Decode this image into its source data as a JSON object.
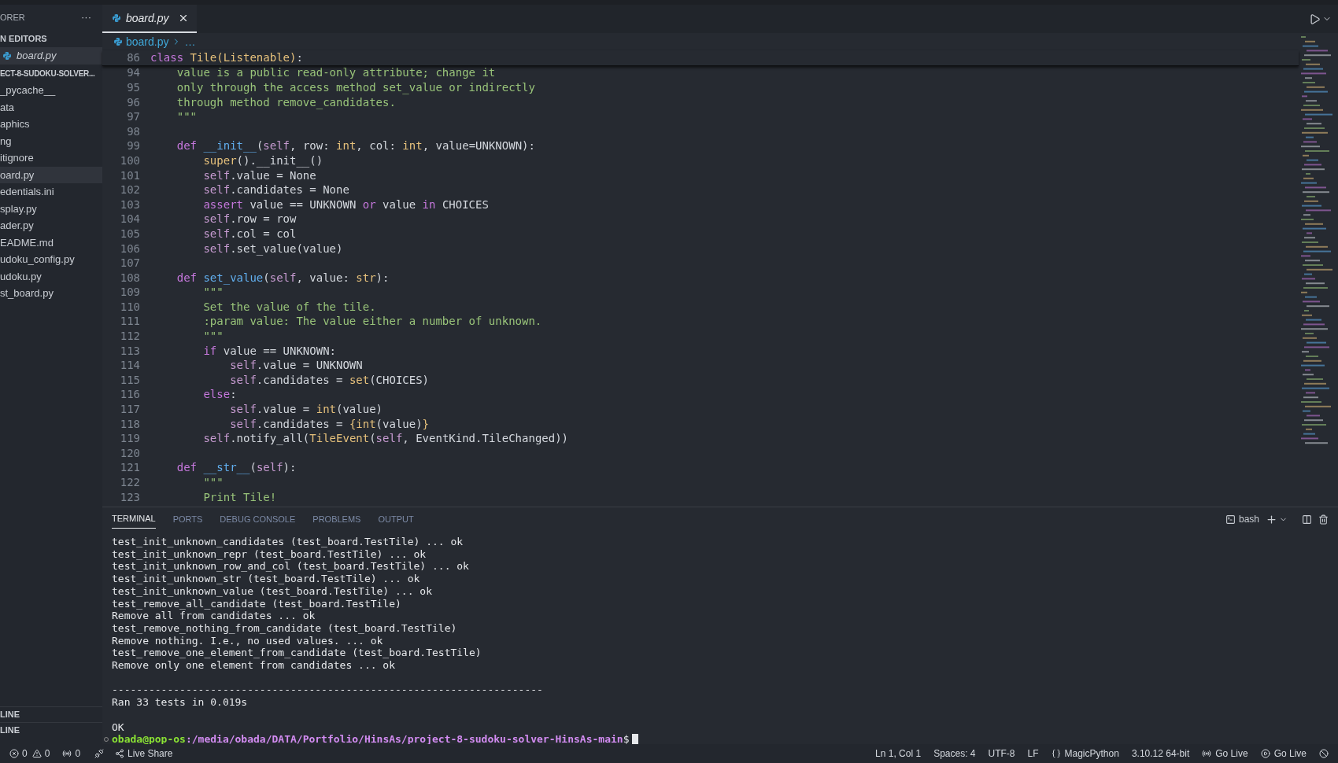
{
  "sidebar": {
    "title": "ORER",
    "more": "···",
    "open_editors": {
      "label": "N EDITORS",
      "items": [
        {
          "name": "board.py",
          "selected": true
        }
      ]
    },
    "folder": {
      "label": "ECT-8-SUDOKU-SOLVER...",
      "items": [
        {
          "name": "_pycache__",
          "selected": false
        },
        {
          "name": "ata",
          "selected": false
        },
        {
          "name": "aphics",
          "selected": false
        },
        {
          "name": "ng",
          "selected": false
        },
        {
          "name": "itignore",
          "selected": false
        },
        {
          "name": "oard.py",
          "selected": true
        },
        {
          "name": "edentials.ini",
          "selected": false
        },
        {
          "name": "splay.py",
          "selected": false
        },
        {
          "name": "ader.py",
          "selected": false
        },
        {
          "name": "EADME.md",
          "selected": false
        },
        {
          "name": "udoku_config.py",
          "selected": false
        },
        {
          "name": "udoku.py",
          "selected": false
        },
        {
          "name": "st_board.py",
          "selected": false
        }
      ]
    },
    "bottom_sections": [
      "LINE",
      "LINE"
    ]
  },
  "editor": {
    "tabs": [
      {
        "label": "board.py",
        "selected": true
      }
    ],
    "breadcrumb": [
      "board.py",
      "…"
    ],
    "sticky_line": {
      "number": "86",
      "tokens": [
        {
          "text": "class ",
          "kind": "kw"
        },
        {
          "text": "Tile(Listenable)",
          "kind": "cls"
        },
        {
          "text": ":",
          "kind": "plain"
        }
      ]
    },
    "lines": [
      {
        "number": "94",
        "tokens": [
          {
            "text": "    value is a public read-only attribute; change it",
            "kind": "str"
          }
        ]
      },
      {
        "number": "95",
        "tokens": [
          {
            "text": "    only through the access method set_value or indirectly",
            "kind": "str"
          }
        ]
      },
      {
        "number": "96",
        "tokens": [
          {
            "text": "    through method remove_candidates.",
            "kind": "str"
          }
        ]
      },
      {
        "number": "97",
        "tokens": [
          {
            "text": "    \"\"\"",
            "kind": "str"
          }
        ]
      },
      {
        "number": "98"
      },
      {
        "number": "99",
        "tokens": [
          {
            "text": "    def ",
            "kind": "kw"
          },
          {
            "text": "__init__",
            "kind": "fn"
          },
          {
            "text": "(",
            "kind": "plain"
          },
          {
            "text": "self",
            "kind": "self"
          },
          {
            "text": ", row: ",
            "kind": "plain"
          },
          {
            "text": "int",
            "kind": "cls"
          },
          {
            "text": ", col: ",
            "kind": "plain"
          },
          {
            "text": "int",
            "kind": "cls"
          },
          {
            "text": ", value=UNKNOWN):",
            "kind": "plain"
          }
        ]
      },
      {
        "number": "100",
        "tokens": [
          {
            "text": "        super",
            "kind": "cls"
          },
          {
            "text": "().__init__()",
            "kind": "plain"
          }
        ]
      },
      {
        "number": "101",
        "tokens": [
          {
            "text": "        self",
            "kind": "self"
          },
          {
            "text": ".value = None",
            "kind": "plain"
          }
        ]
      },
      {
        "number": "102",
        "tokens": [
          {
            "text": "        self",
            "kind": "self"
          },
          {
            "text": ".candidates = None",
            "kind": "plain"
          }
        ]
      },
      {
        "number": "103",
        "tokens": [
          {
            "text": "        assert",
            "kind": "kw"
          },
          {
            "text": " value == UNKNOWN ",
            "kind": "plain"
          },
          {
            "text": "or",
            "kind": "kw"
          },
          {
            "text": " value ",
            "kind": "plain"
          },
          {
            "text": "in",
            "kind": "kw"
          },
          {
            "text": " CHOICES",
            "kind": "plain"
          }
        ]
      },
      {
        "number": "104",
        "tokens": [
          {
            "text": "        self",
            "kind": "self"
          },
          {
            "text": ".row = row",
            "kind": "plain"
          }
        ]
      },
      {
        "number": "105",
        "tokens": [
          {
            "text": "        self",
            "kind": "self"
          },
          {
            "text": ".col = col",
            "kind": "plain"
          }
        ]
      },
      {
        "number": "106",
        "tokens": [
          {
            "text": "        self",
            "kind": "self"
          },
          {
            "text": ".set_value(value)",
            "kind": "plain"
          }
        ]
      },
      {
        "number": "107"
      },
      {
        "number": "108",
        "tokens": [
          {
            "text": "    def ",
            "kind": "kw"
          },
          {
            "text": "set_value",
            "kind": "fn"
          },
          {
            "text": "(",
            "kind": "plain"
          },
          {
            "text": "self",
            "kind": "self"
          },
          {
            "text": ", value: ",
            "kind": "plain"
          },
          {
            "text": "str",
            "kind": "cls"
          },
          {
            "text": "):",
            "kind": "plain"
          }
        ]
      },
      {
        "number": "109",
        "tokens": [
          {
            "text": "        \"\"\"",
            "kind": "str"
          }
        ]
      },
      {
        "number": "110",
        "tokens": [
          {
            "text": "        Set the value of the tile.",
            "kind": "str"
          }
        ]
      },
      {
        "number": "111",
        "tokens": [
          {
            "text": "        :param value: The value either a number of unknown.",
            "kind": "str"
          }
        ]
      },
      {
        "number": "112",
        "tokens": [
          {
            "text": "        \"\"\"",
            "kind": "str"
          }
        ]
      },
      {
        "number": "113",
        "tokens": [
          {
            "text": "        if",
            "kind": "kw"
          },
          {
            "text": " value == UNKNOWN:",
            "kind": "plain"
          }
        ]
      },
      {
        "number": "114",
        "tokens": [
          {
            "text": "            self",
            "kind": "self"
          },
          {
            "text": ".value = UNKNOWN",
            "kind": "plain"
          }
        ]
      },
      {
        "number": "115",
        "tokens": [
          {
            "text": "            self",
            "kind": "self"
          },
          {
            "text": ".candidates = ",
            "kind": "plain"
          },
          {
            "text": "set",
            "kind": "cls"
          },
          {
            "text": "(CHOICES)",
            "kind": "plain"
          }
        ]
      },
      {
        "number": "116",
        "tokens": [
          {
            "text": "        else",
            "kind": "kw"
          },
          {
            "text": ":",
            "kind": "plain"
          }
        ]
      },
      {
        "number": "117",
        "tokens": [
          {
            "text": "            self",
            "kind": "self"
          },
          {
            "text": ".value = ",
            "kind": "plain"
          },
          {
            "text": "int",
            "kind": "cls"
          },
          {
            "text": "(value)",
            "kind": "plain"
          }
        ]
      },
      {
        "number": "118",
        "tokens": [
          {
            "text": "            self",
            "kind": "self"
          },
          {
            "text": ".candidates = ",
            "kind": "plain"
          },
          {
            "text": "{int",
            "kind": "cls"
          },
          {
            "text": "(value)",
            "kind": "plain"
          },
          {
            "text": "}",
            "kind": "cls"
          }
        ]
      },
      {
        "number": "119",
        "tokens": [
          {
            "text": "        self",
            "kind": "self"
          },
          {
            "text": ".notify_all(",
            "kind": "plain"
          },
          {
            "text": "TileEvent",
            "kind": "cls"
          },
          {
            "text": "(",
            "kind": "plain"
          },
          {
            "text": "self",
            "kind": "self"
          },
          {
            "text": ", EventKind.TileChanged))",
            "kind": "plain"
          }
        ]
      },
      {
        "number": "120"
      },
      {
        "number": "121",
        "tokens": [
          {
            "text": "    def ",
            "kind": "kw"
          },
          {
            "text": "__str__",
            "kind": "fn"
          },
          {
            "text": "(",
            "kind": "plain"
          },
          {
            "text": "self",
            "kind": "self"
          },
          {
            "text": "):",
            "kind": "plain"
          }
        ]
      },
      {
        "number": "122",
        "tokens": [
          {
            "text": "        \"\"\"",
            "kind": "str"
          }
        ]
      },
      {
        "number": "123",
        "tokens": [
          {
            "text": "        Print Tile!",
            "kind": "str"
          }
        ]
      }
    ]
  },
  "panel": {
    "tabs": [
      {
        "label": "TERMINAL",
        "selected": true
      },
      {
        "label": "PORTS",
        "selected": false
      },
      {
        "label": "DEBUG CONSOLE",
        "selected": false
      },
      {
        "label": "PROBLEMS",
        "selected": false
      },
      {
        "label": "OUTPUT",
        "selected": false
      }
    ],
    "shell": "bash",
    "blocks": [
      {
        "lines": [
          "test_init_unknown_candidates (test_board.TestTile) ... ok",
          "test_init_unknown_repr (test_board.TestTile) ... ok",
          "test_init_unknown_row_and_col (test_board.TestTile) ... ok",
          "test_init_unknown_str (test_board.TestTile) ... ok",
          "test_init_unknown_value (test_board.TestTile) ... ok",
          "test_remove_all_candidate (test_board.TestTile)",
          "Remove all from candidates ... ok",
          "test_remove_nothing_from_candidate (test_board.TestTile)",
          "Remove nothing. I.e., no used values. ... ok",
          "test_remove_one_element_from_candidate (test_board.TestTile)",
          "Remove only one element from candidates ... ok"
        ]
      },
      {
        "lines": [
          "----------------------------------------------------------------------",
          "Ran 33 tests in 0.019s"
        ]
      },
      {
        "lines": [
          "OK"
        ]
      }
    ],
    "prompt": {
      "user": "obada@pop-os",
      "path": ":/media/obada/DATA/Portfolio/HinsAs/project-8-sudoku-solver-HinsAs-main",
      "symbol": "$"
    }
  },
  "status_bar": {
    "errors": "0",
    "warnings": "0",
    "ports": "0",
    "live_share": "Live Share",
    "right": [
      {
        "text": "Ln 1, Col 1",
        "kind": "text"
      },
      {
        "text": "Spaces: 4",
        "kind": "text"
      },
      {
        "text": "UTF-8",
        "kind": "text"
      },
      {
        "text": "LF",
        "kind": "text"
      },
      {
        "text": "MagicPython",
        "kind": "language"
      },
      {
        "text": "3.10.12 64-bit",
        "kind": "text"
      },
      {
        "text": "Go Live",
        "kind": "broadcast"
      },
      {
        "text": "Go Live",
        "kind": "play"
      }
    ]
  }
}
